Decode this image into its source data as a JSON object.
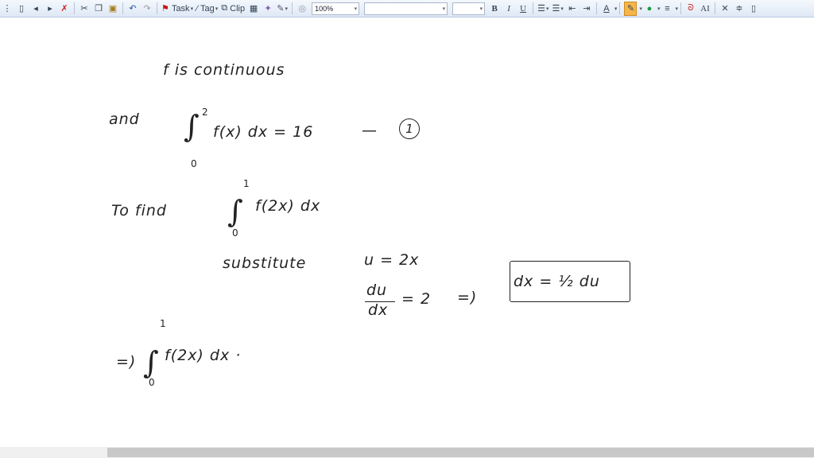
{
  "toolbar": {
    "task_label": "Task",
    "tag_label": "Tag",
    "clip_label": "Clip",
    "zoom_value": "100%",
    "font_name": "",
    "font_size": "",
    "bold": "B",
    "italic": "I",
    "underline": "U",
    "font_color": "A",
    "text_size": "AI",
    "highlighter_color": "#f5a623"
  },
  "note": {
    "line1": "f is continuous",
    "and": "and",
    "integral1": {
      "lower": "0",
      "upper": "2",
      "expr": "f(x) dx = 16",
      "dash": "—",
      "marker": "1"
    },
    "to_find": "To find",
    "integral2": {
      "lower": "0",
      "upper": "1",
      "expr": "f(2x) dx"
    },
    "substitute": "substitute",
    "u_eq": "u = 2x",
    "du": "du",
    "dx": "dx",
    "eq2": "= 2",
    "implies": "=)",
    "boxed": "dx = ½ du",
    "implies2": "=)",
    "integral3": {
      "lower": "0",
      "upper": "1",
      "expr": "f(2x) dx ·"
    }
  }
}
